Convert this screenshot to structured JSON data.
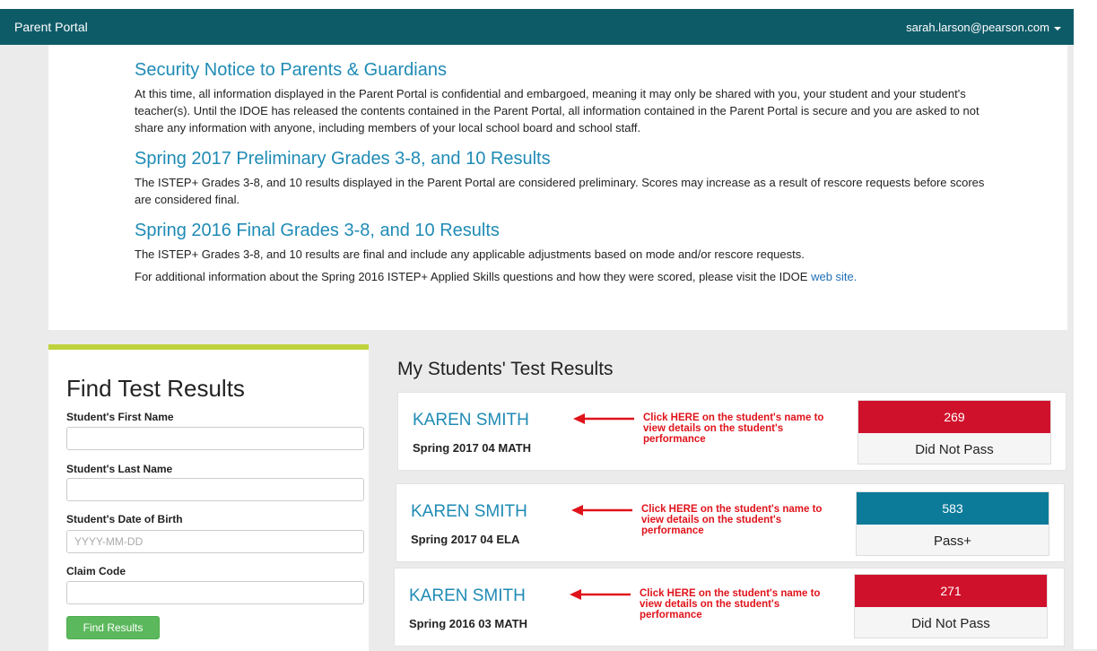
{
  "header": {
    "brand": "Parent Portal",
    "user_email": "sarah.larson@pearson.com"
  },
  "notices": [
    {
      "title": "Security Notice to Parents & Guardians",
      "paragraphs": [
        "At this time, all information displayed in the Parent Portal is confidential and embargoed, meaning it may only be shared with you, your student and your student's teacher(s). Until the IDOE has released the contents contained in the Parent Portal, all information contained in the Parent Portal is secure and you are asked to not share any information with anyone, including members of your local school board and school staff."
      ]
    },
    {
      "title": "Spring 2017 Preliminary Grades 3-8, and 10 Results",
      "paragraphs": [
        "The ISTEP+ Grades 3-8, and 10 results displayed in the Parent Portal are considered preliminary. Scores may increase as a result of rescore requests before scores are considered final."
      ]
    },
    {
      "title": "Spring 2016 Final Grades 3-8, and 10 Results",
      "paragraphs": [
        "The ISTEP+ Grades 3-8, and 10 results are final and include any applicable adjustments based on mode and/or rescore requests.",
        "For additional information about the Spring 2016 ISTEP+ Applied Skills questions and how they were scored, please visit the IDOE "
      ],
      "link_text": "web site."
    }
  ],
  "find": {
    "title": "Find Test Results",
    "first_name_label": "Student's First Name",
    "last_name_label": "Student's Last Name",
    "dob_label": "Student's Date of Birth",
    "dob_placeholder": "YYYY-MM-DD",
    "claim_label": "Claim Code",
    "button": "Find Results"
  },
  "results": {
    "title": "My Students' Test Results",
    "note": "Click HERE on the student's name to view details on the student's performance",
    "accent_fail": "#d0112b",
    "accent_pass": "#0c7b9a",
    "items": [
      {
        "name": "KAREN SMITH",
        "test": "Spring 2017 04 MATH",
        "score": "269",
        "status": "Did Not Pass"
      },
      {
        "name": "KAREN SMITH",
        "test": "Spring 2017 04 ELA",
        "score": "583",
        "status": "Pass+"
      },
      {
        "name": "KAREN SMITH",
        "test": "Spring 2016 03 MATH",
        "score": "271",
        "status": "Did Not Pass"
      }
    ]
  }
}
